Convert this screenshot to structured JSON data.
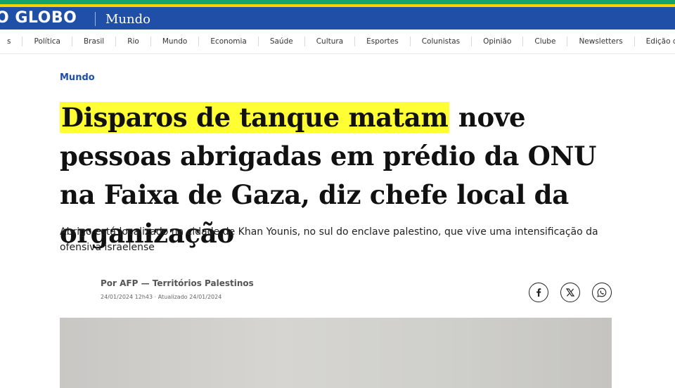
{
  "header": {
    "brand": "O GLOBO",
    "section": "Mundo",
    "colors": {
      "blue": "#1f4fa6",
      "green": "#16a36a",
      "yellow": "#f7d400"
    }
  },
  "nav": {
    "items": [
      "s",
      "Política",
      "Brasil",
      "Rio",
      "Mundo",
      "Economia",
      "Saúde",
      "Cultura",
      "Esportes",
      "Colunistas",
      "Opinião",
      "Clube",
      "Newsletters",
      "Edição d"
    ]
  },
  "article": {
    "category": "Mundo",
    "headline_highlighted": "Disparos de tanque matam",
    "headline_rest": " nove pessoas abrigadas em prédio da ONU na Faixa de Gaza, diz chefe local da organização",
    "highlight_color": "#ffff33",
    "subtitle": "Abrigo está localizado na cidade de Khan Younis, no sul do enclave palestino, que vive uma intensificação da ofensiva israelense",
    "byline": "Por AFP — Territórios Palestinos",
    "dates": "24/01/2024 12h43 · Atualizado 24/01/2024"
  },
  "share": {
    "icons": [
      "facebook-icon",
      "x-icon",
      "whatsapp-icon"
    ]
  }
}
